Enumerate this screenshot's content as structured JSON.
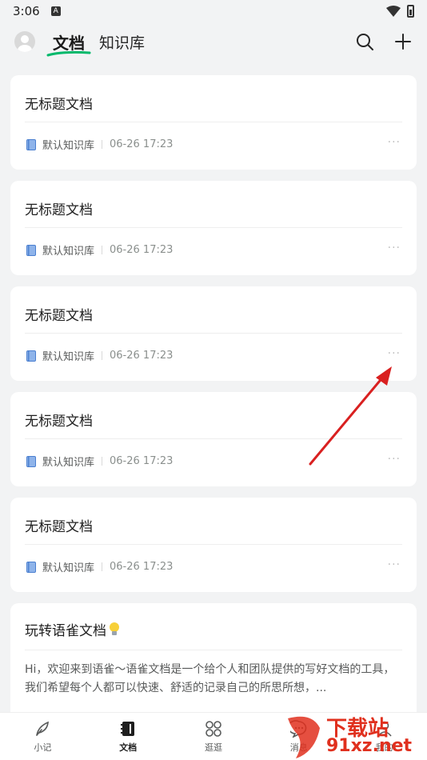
{
  "status_bar": {
    "time": "3:06",
    "notification_glyph": "A"
  },
  "header": {
    "tab_docs": "文档",
    "tab_knowledge": "知识库",
    "accent_color": "#00b96b"
  },
  "docs": [
    {
      "title": "无标题文档",
      "repo": "默认知识库",
      "time": "06-26 17:23"
    },
    {
      "title": "无标题文档",
      "repo": "默认知识库",
      "time": "06-26 17:23"
    },
    {
      "title": "无标题文档",
      "repo": "默认知识库",
      "time": "06-26 17:23"
    },
    {
      "title": "无标题文档",
      "repo": "默认知识库",
      "time": "06-26 17:23"
    },
    {
      "title": "无标题文档",
      "repo": "默认知识库",
      "time": "06-26 17:23"
    }
  ],
  "more_glyph": "···",
  "intro": {
    "title": "玩转语雀文档",
    "body": "Hi，欢迎来到语雀～语雀文档是一个给个人和团队提供的写好文档的工具，我们希望每个人都可以快速、舒适的记录自己的所思所想，..."
  },
  "bottom_nav": [
    {
      "label": "小记",
      "icon": "feather-icon"
    },
    {
      "label": "文档",
      "icon": "notebook-icon",
      "active": true
    },
    {
      "label": "逛逛",
      "icon": "grid-icon"
    },
    {
      "label": "消息",
      "icon": "chat-icon"
    },
    {
      "label": "我的",
      "icon": "user-icon"
    }
  ],
  "watermark": {
    "top": "下载站",
    "bottom": "91xz.net"
  }
}
